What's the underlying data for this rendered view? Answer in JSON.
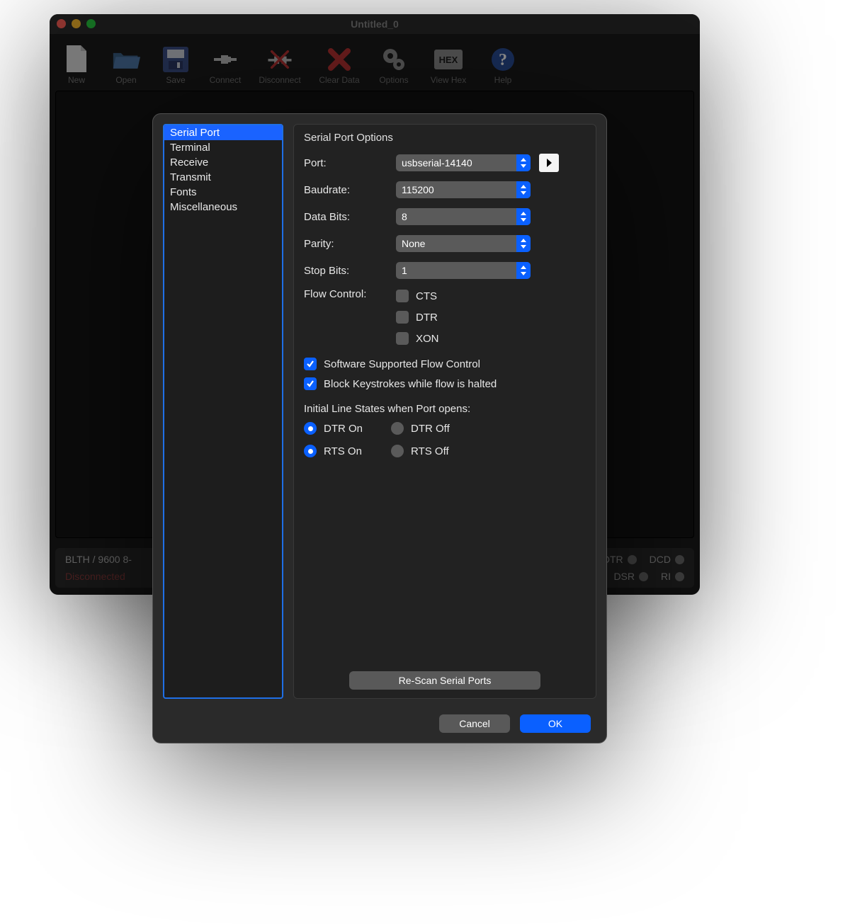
{
  "window": {
    "title": "Untitled_0",
    "toolbar": [
      {
        "name": "new",
        "label": "New"
      },
      {
        "name": "open",
        "label": "Open"
      },
      {
        "name": "save",
        "label": "Save"
      },
      {
        "name": "connect",
        "label": "Connect"
      },
      {
        "name": "disconnect",
        "label": "Disconnect"
      },
      {
        "name": "clear-data",
        "label": "Clear Data"
      },
      {
        "name": "options",
        "label": "Options"
      },
      {
        "name": "view-hex",
        "label": "View Hex"
      },
      {
        "name": "help",
        "label": "Help"
      }
    ],
    "status": {
      "line1_left": "BLTH / 9600 8-",
      "line2_left": "Disconnected",
      "signals_row1": [
        {
          "name": "DTR"
        },
        {
          "name": "DCD"
        }
      ],
      "signals_row2": [
        {
          "name": "DSR"
        },
        {
          "name": "RI"
        }
      ]
    }
  },
  "dialog": {
    "sidebar": [
      "Serial Port",
      "Terminal",
      "Receive",
      "Transmit",
      "Fonts",
      "Miscellaneous"
    ],
    "selected_index": 0,
    "panel_title": "Serial Port Options",
    "fields": {
      "port": {
        "label": "Port:",
        "value": "usbserial-14140"
      },
      "baud": {
        "label": "Baudrate:",
        "value": "115200"
      },
      "data": {
        "label": "Data Bits:",
        "value": "8"
      },
      "parity": {
        "label": "Parity:",
        "value": "None"
      },
      "stop": {
        "label": "Stop Bits:",
        "value": "1"
      }
    },
    "flow_label": "Flow Control:",
    "flow_opts": [
      {
        "name": "cts",
        "label": "CTS",
        "checked": false
      },
      {
        "name": "dtr",
        "label": "DTR",
        "checked": false
      },
      {
        "name": "xon",
        "label": "XON",
        "checked": false
      }
    ],
    "sw_flow": {
      "label": "Software Supported Flow Control",
      "checked": true
    },
    "block_keys": {
      "label": "Block Keystrokes while flow is halted",
      "checked": true
    },
    "initial_heading": "Initial Line States when Port opens:",
    "dtr_group": {
      "on": "DTR On",
      "off": "DTR Off",
      "value": "on"
    },
    "rts_group": {
      "on": "RTS On",
      "off": "RTS Off",
      "value": "on"
    },
    "rescan": "Re-Scan Serial Ports",
    "cancel": "Cancel",
    "ok": "OK"
  }
}
